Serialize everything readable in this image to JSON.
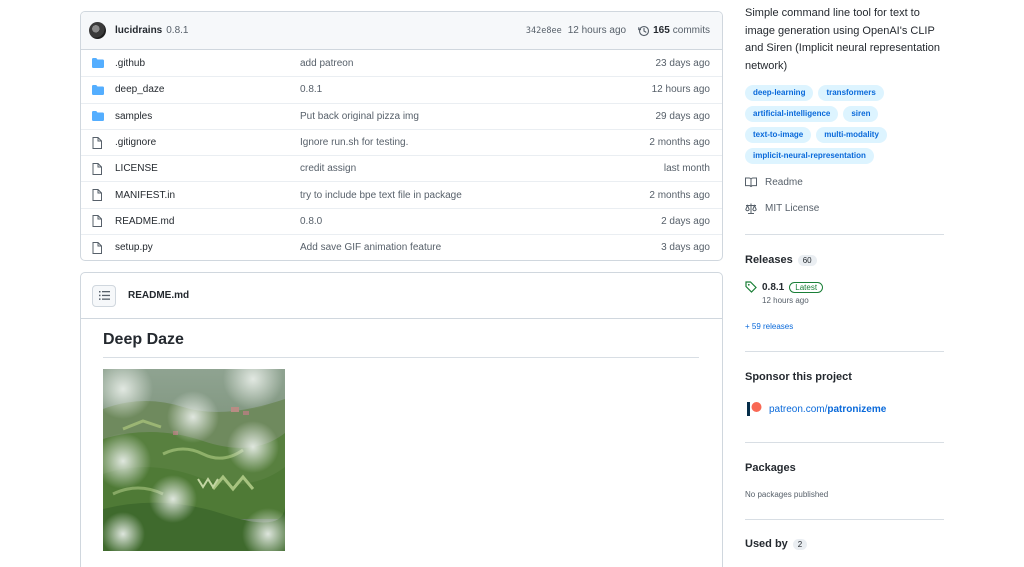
{
  "commit_bar": {
    "author": "lucidrains",
    "message": "0.8.1",
    "sha": "342e8ee",
    "time": "12 hours ago",
    "commits_count": "165",
    "commits_label": "commits"
  },
  "files": [
    {
      "name": ".github",
      "type": "folder",
      "commit": "add patreon",
      "age": "23 days ago"
    },
    {
      "name": "deep_daze",
      "type": "folder",
      "commit": "0.8.1",
      "age": "12 hours ago"
    },
    {
      "name": "samples",
      "type": "folder",
      "commit": "Put back original pizza img",
      "age": "29 days ago"
    },
    {
      "name": ".gitignore",
      "type": "file",
      "commit": "Ignore run.sh for testing.",
      "age": "2 months ago"
    },
    {
      "name": "LICENSE",
      "type": "file",
      "commit": "credit assign",
      "age": "last month"
    },
    {
      "name": "MANIFEST.in",
      "type": "file",
      "commit": "try to include bpe text file in package",
      "age": "2 months ago"
    },
    {
      "name": "README.md",
      "type": "file",
      "commit": "0.8.0",
      "age": "2 days ago"
    },
    {
      "name": "setup.py",
      "type": "file",
      "commit": "Add save GIF animation feature",
      "age": "3 days ago"
    }
  ],
  "readme": {
    "filename": "README.md",
    "title": "Deep Daze"
  },
  "sidebar": {
    "about": "Simple command line tool for text to image generation using OpenAI's CLIP and Siren (Implicit neural representation network)",
    "topics": [
      "deep-learning",
      "transformers",
      "artificial-intelligence",
      "siren",
      "text-to-image",
      "multi-modality",
      "implicit-neural-representation"
    ],
    "readme_link": "Readme",
    "license_link": "MIT License",
    "releases": {
      "heading": "Releases",
      "count": "60",
      "latest_version": "0.8.1",
      "latest_label": "Latest",
      "latest_time": "12 hours ago",
      "more_link": "+ 59 releases"
    },
    "sponsor": {
      "heading": "Sponsor this project",
      "link": "patreon.com/",
      "link_bold": "patronizeme"
    },
    "packages": {
      "heading": "Packages",
      "text": "No packages published"
    },
    "used_by": {
      "heading": "Used by",
      "count": "2"
    }
  },
  "colors": {
    "accent": "#0969da",
    "folder": "#54aeff",
    "green": "#1a7f37",
    "patreon": "#f96854"
  }
}
